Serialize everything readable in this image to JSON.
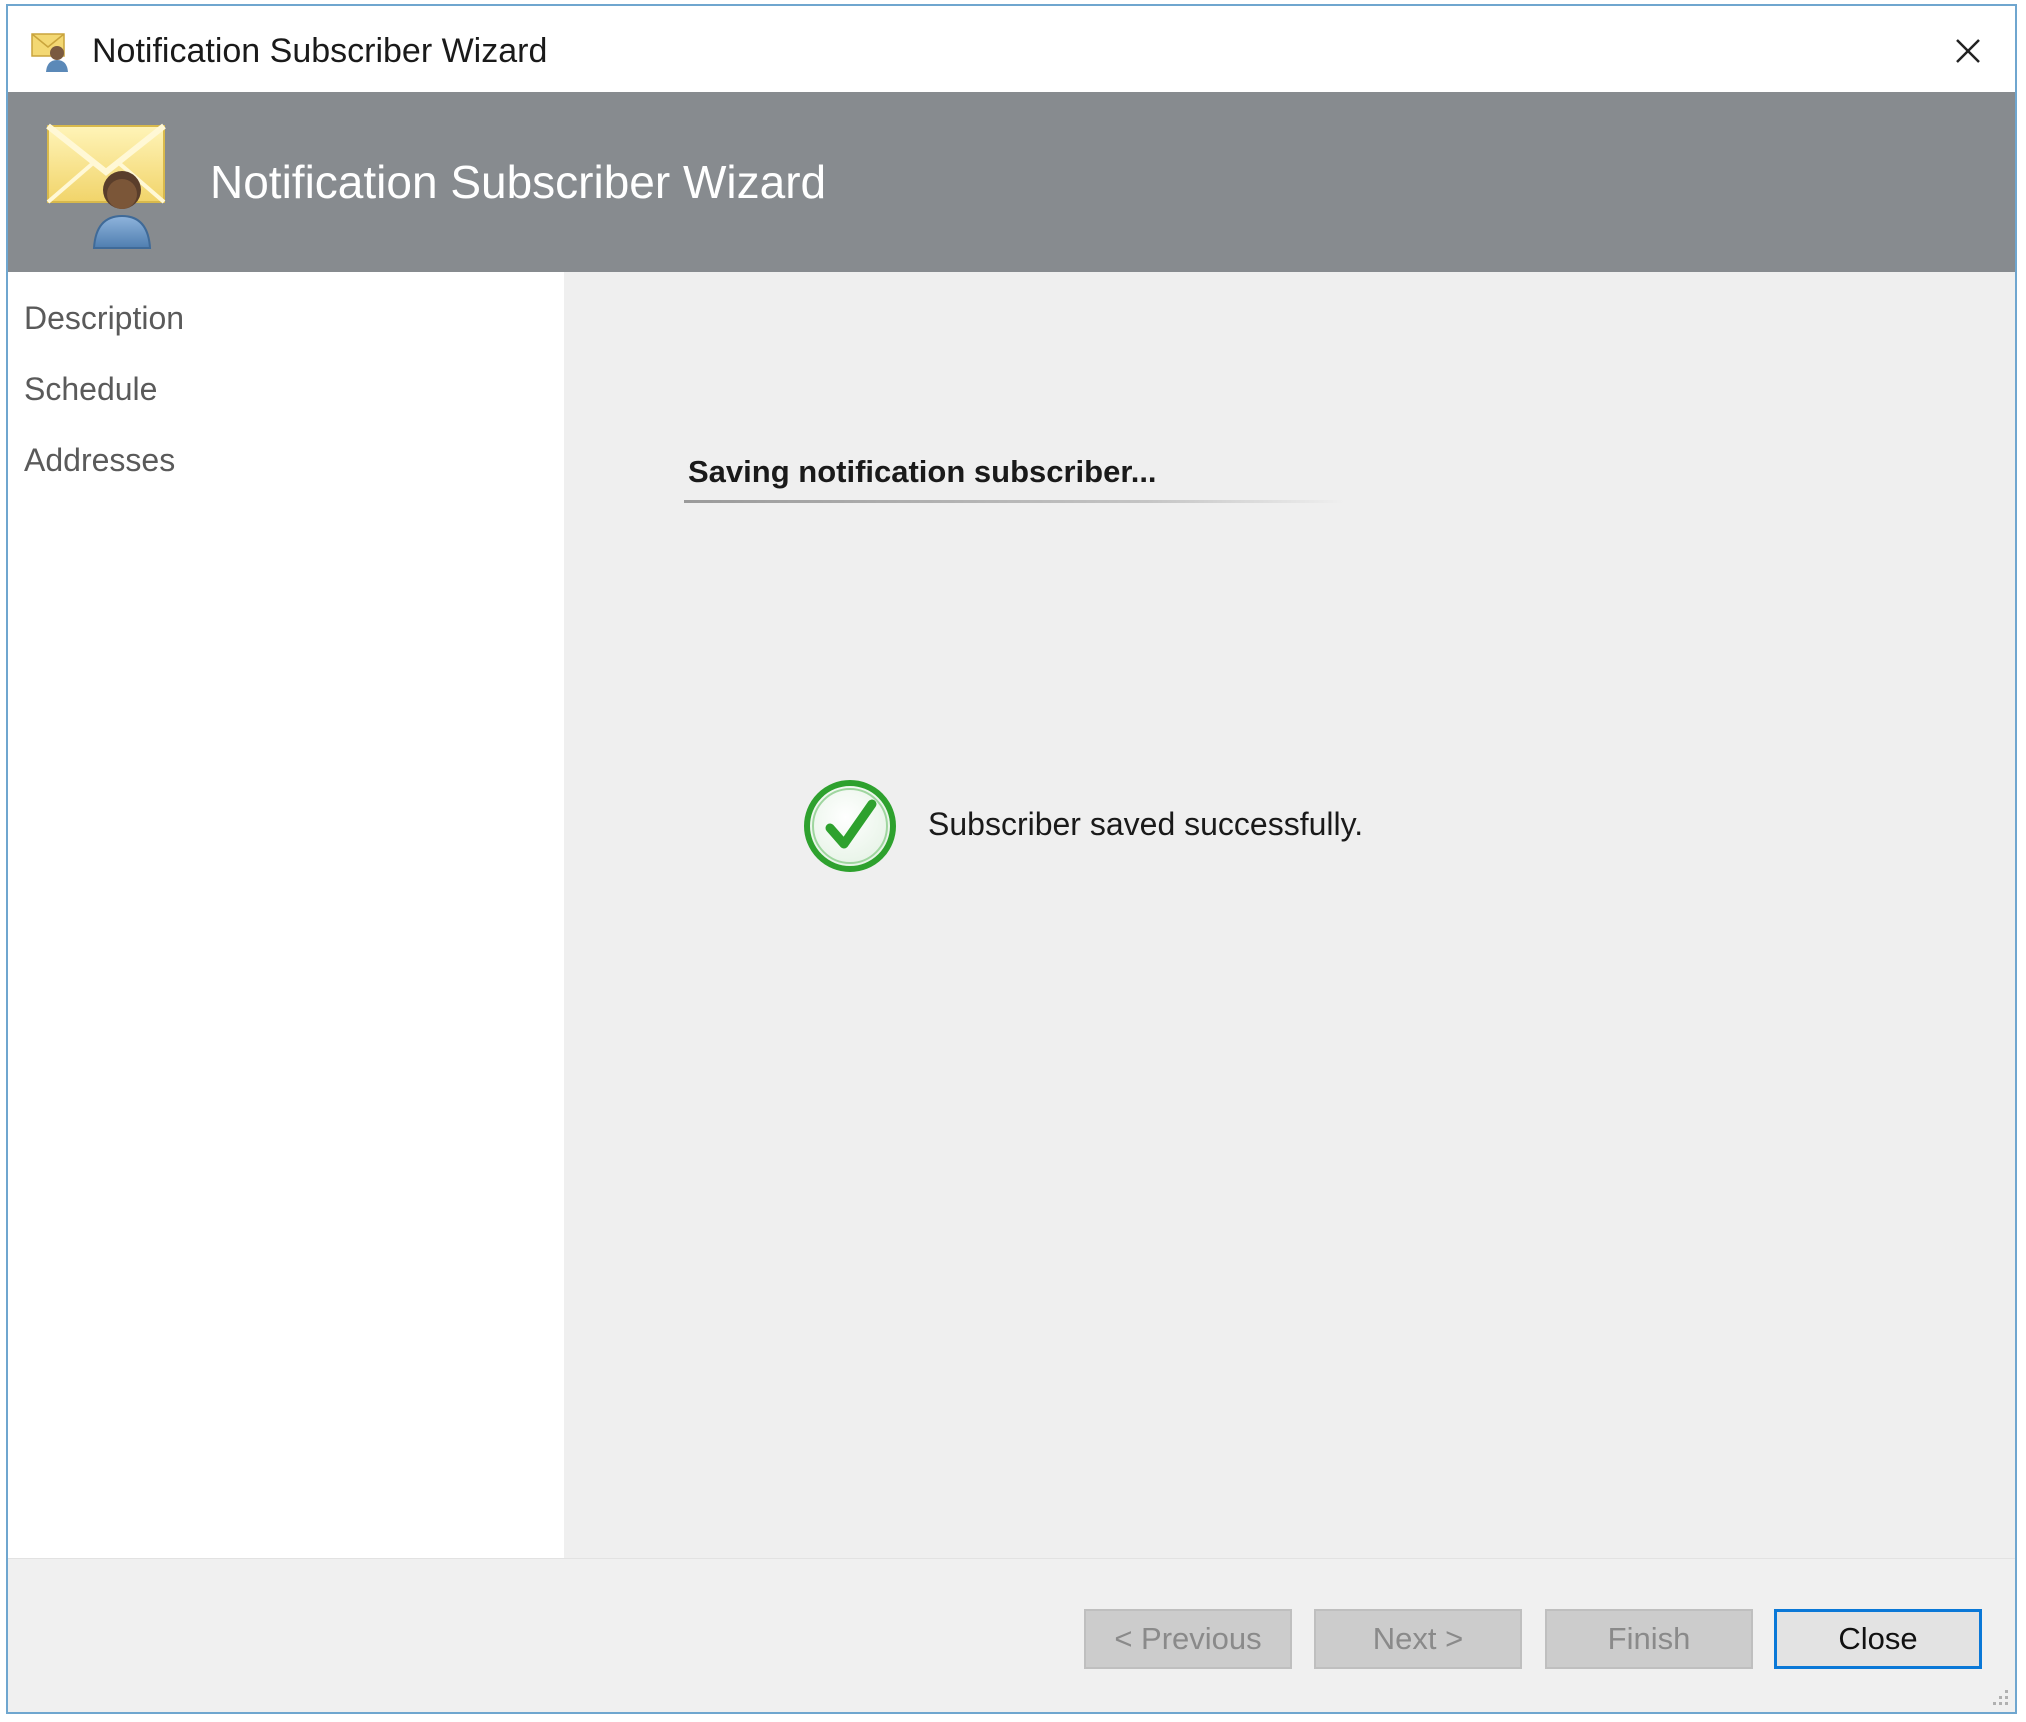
{
  "window": {
    "title": "Notification Subscriber Wizard",
    "close_label": "Close window"
  },
  "header": {
    "title": "Notification Subscriber Wizard"
  },
  "nav": {
    "items": [
      {
        "label": "Description"
      },
      {
        "label": "Schedule"
      },
      {
        "label": "Addresses"
      }
    ]
  },
  "main": {
    "heading": "Saving notification subscriber...",
    "status_icon": "check-circle-icon",
    "status_message": "Subscriber saved successfully."
  },
  "footer": {
    "previous_label": "< Previous",
    "next_label": "Next >",
    "finish_label": "Finish",
    "close_label": "Close"
  },
  "colors": {
    "header_band": "#878b8f",
    "content_bg": "#efefef",
    "accent_border": "#0a78d7",
    "success_green": "#2ea12e"
  }
}
